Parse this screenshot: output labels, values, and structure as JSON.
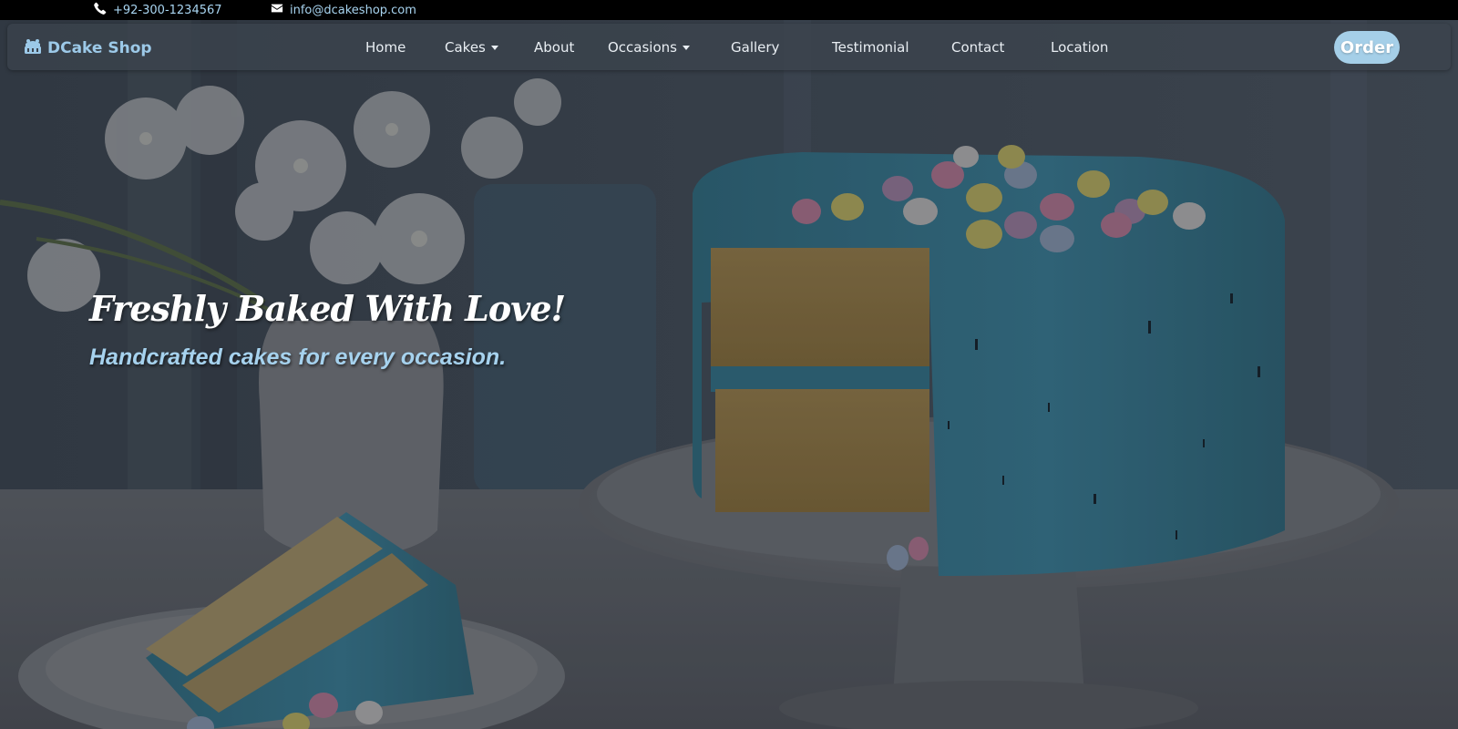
{
  "topbar": {
    "phone": "+92-300-1234567",
    "phone_icon": "phone-icon",
    "email": "info@dcakeshop.com",
    "email_icon": "envelope-icon"
  },
  "navbar": {
    "brand": "DCake Shop",
    "brand_icon": "cake-icon",
    "links": [
      {
        "label": "Home",
        "dropdown": false
      },
      {
        "label": "Cakes",
        "dropdown": true
      },
      {
        "label": "About",
        "dropdown": false
      },
      {
        "label": "Occasions",
        "dropdown": true
      },
      {
        "label": "Gallery",
        "dropdown": false
      },
      {
        "label": "Testimonial",
        "dropdown": false
      },
      {
        "label": "Contact",
        "dropdown": false
      },
      {
        "label": "Location",
        "dropdown": false
      }
    ],
    "order_label": "Order"
  },
  "hero": {
    "tagline": "Freshly Baked With Love!",
    "subtitle": "Handcrafted cakes for every occasion."
  },
  "colors": {
    "accent": "#a5cfe8",
    "topbar_bg": "#000000",
    "frosting": "#3a7d93"
  }
}
